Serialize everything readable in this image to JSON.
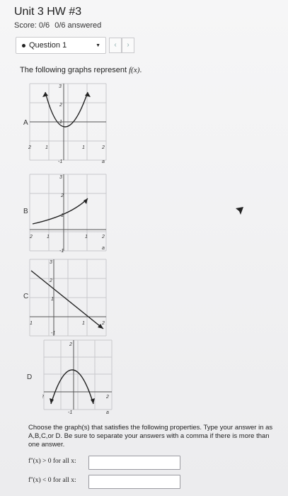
{
  "header": {
    "title": "Unit 3 HW #3",
    "score_label": "Score: 0/6",
    "answered_label": "0/6 answered"
  },
  "question_selector": {
    "label": "Question 1",
    "prev_glyph": "‹",
    "next_glyph": "›"
  },
  "prompt": {
    "text": "The following graphs represent f(x).",
    "prefix": "The following graphs represent ",
    "func": "f(x)",
    "suffix": "."
  },
  "graphs": [
    {
      "label": "A"
    },
    {
      "label": "B"
    },
    {
      "label": "C"
    },
    {
      "label": "D"
    }
  ],
  "instructions": "Choose the graph(s) that satisfies the following properties. Type your answer in as A,B,C,or D. Be sure to separate your answers with a comma if there is more than one answer.",
  "conditions": [
    {
      "text": "f''(x) > 0 for all x:",
      "value": ""
    },
    {
      "text": "f''(x) < 0 for all x:",
      "value": ""
    }
  ]
}
